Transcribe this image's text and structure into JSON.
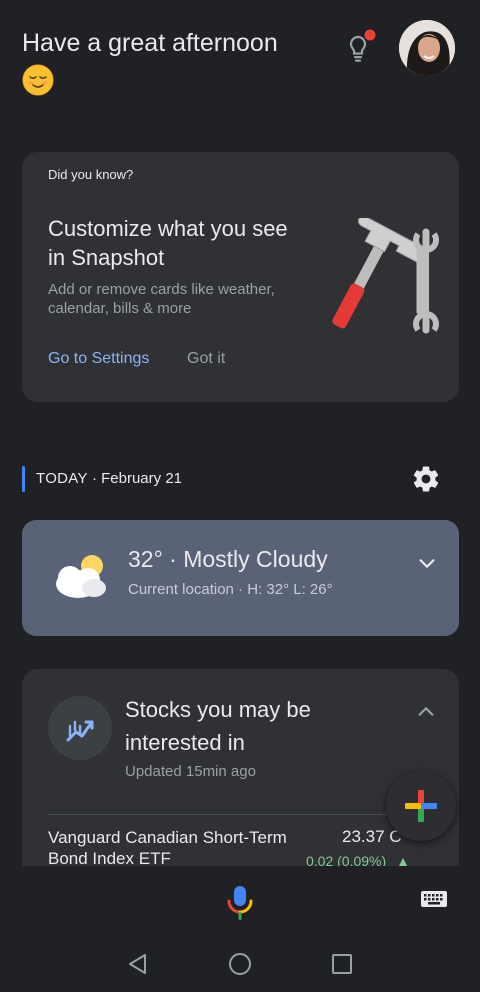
{
  "header": {
    "greeting": "Have a great afternoon",
    "emoji_icon": "relieved-face-icon",
    "tips_icon": "lightbulb-notification-icon",
    "avatar": "user-avatar"
  },
  "did_you_know": {
    "eyebrow": "Did you know?",
    "title": "Customize what you see in Snapshot",
    "body": "Add or remove cards like weather, calendar, bills & more",
    "primary_action": "Go to Settings",
    "secondary_action": "Got it",
    "illustration": "hammer-wrench-icon"
  },
  "today": {
    "label": "TODAY",
    "date": " · February 21",
    "settings_icon": "gear-icon"
  },
  "weather": {
    "title": "32° · Mostly Cloudy",
    "subtitle": "Current location · H: 32° L: 26°",
    "icon": "partly-cloudy-icon"
  },
  "stocks": {
    "title": "Stocks you may be interested in",
    "updated": "Updated 15min ago",
    "icon": "stock-chart-icon",
    "items": [
      {
        "name": "Vanguard Canadian Short-Term Bond Index ETF",
        "price": "23.37 C",
        "change": "0.02 (0.09%)"
      }
    ]
  },
  "fab": {
    "icon": "google-plus-icon"
  },
  "bottom": {
    "mic_icon": "mic-icon",
    "keyboard_icon": "keyboard-icon"
  },
  "nav": {
    "back": "back-icon",
    "home": "home-icon",
    "recents": "recents-icon"
  },
  "colors": {
    "background": "#202124",
    "card": "#303134",
    "weather_card": "#5a6277",
    "link": "#8ab4f8",
    "accent": "#4285f4",
    "positive": "#81c995"
  }
}
